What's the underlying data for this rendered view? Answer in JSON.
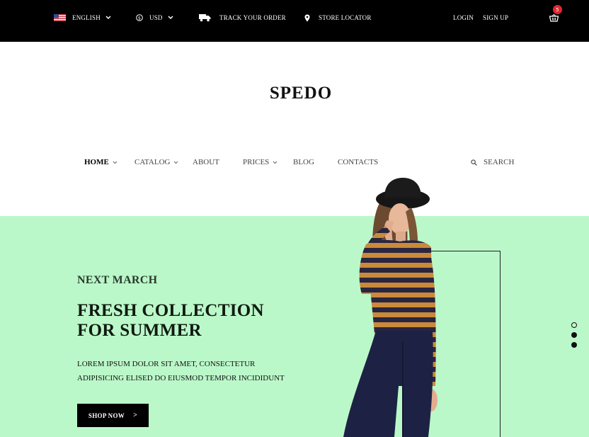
{
  "topbar": {
    "language": "ENGLISH",
    "currency": "USD",
    "track_order": "TRACK YOUR ORDER",
    "store_locator": "STORE LOCATOR",
    "login": "LOGIN",
    "signup": "SIGN UP",
    "cart_count": "5"
  },
  "brand": {
    "logo": "SPEDO"
  },
  "nav": {
    "items": [
      "HOME",
      "CATALOG",
      "ABOUT",
      "PRICES",
      "BLOG",
      "CONTACTS"
    ],
    "active": "HOME",
    "search_label": "SEARCH"
  },
  "hero": {
    "kicker": "NEXT MARCH",
    "title_line1": "FRESH COLLECTION",
    "title_line2": "FOR SUMMER",
    "text_line1": "LOREM IPSUM DOLOR SIT AMET, CONSECTETUR",
    "text_line2": "ADIPISICING ELISED DO EIUSMOD TEMPOR INCIDIDUNT",
    "button": "SHOP NOW",
    "button_arrow": ">",
    "background": "#bbf8c9"
  },
  "slider": {
    "count": 3,
    "active_index": 0
  }
}
